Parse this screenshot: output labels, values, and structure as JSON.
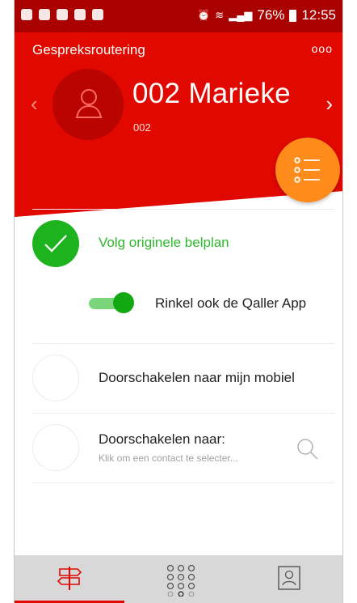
{
  "status_bar": {
    "battery": "76%",
    "time": "12:55"
  },
  "header": {
    "title": "Gespreksroutering",
    "menu_dots": "ooo",
    "prev_arrow": "‹",
    "next_arrow": "›"
  },
  "contact": {
    "name": "002 Marieke",
    "number": "002"
  },
  "options": {
    "follow_plan": "Volg originele belplan",
    "ring_app": "Rinkel ook de Qaller App",
    "forward_mobile": "Doorschakelen naar mijn mobiel",
    "forward_to": "Doorschakelen naar:",
    "forward_to_placeholder": "Klik om een contact te selecter..."
  },
  "toggle": {
    "ring_app_on": true
  },
  "colors": {
    "header_red": "#e10800",
    "status_red": "#a90000",
    "fab_orange": "#ff8c1a",
    "check_green": "#1db31f",
    "accent_red": "#e10800"
  },
  "tabs": [
    {
      "icon": "signpost-icon",
      "active": true
    },
    {
      "icon": "dialpad-icon",
      "active": false
    },
    {
      "icon": "contact-card-icon",
      "active": false
    }
  ]
}
